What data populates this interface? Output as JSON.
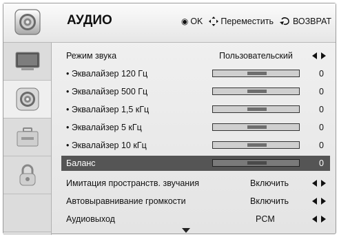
{
  "header": {
    "title": "АУДИО",
    "hint_ok": "OK",
    "hint_move": "Переместить",
    "hint_back": "ВОЗВРАТ"
  },
  "sidebar": {
    "items": [
      {
        "icon": "tv-screen-icon",
        "active": false
      },
      {
        "icon": "speaker-icon",
        "active": true
      },
      {
        "icon": "toolbox-icon",
        "active": false
      },
      {
        "icon": "lock-icon",
        "active": false
      }
    ]
  },
  "settings": [
    {
      "label": "Режим звука",
      "value": "Пользовательский",
      "control": "arrows"
    },
    {
      "label": "• Эквалайзер 120 Гц",
      "value": "0",
      "control": "slider"
    },
    {
      "label": "• Эквалайзер 500 Гц",
      "value": "0",
      "control": "slider"
    },
    {
      "label": "• Эквалайзер 1,5 кГц",
      "value": "0",
      "control": "slider"
    },
    {
      "label": "• Эквалайзер 5 кГц",
      "value": "0",
      "control": "slider"
    },
    {
      "label": "• Эквалайзер 10 кГц",
      "value": "0",
      "control": "slider"
    },
    {
      "label": "Баланс",
      "value": "0",
      "control": "slider",
      "selected": true
    },
    {
      "label": "Имитация пространств. звучания",
      "value": "Включить",
      "control": "arrows"
    },
    {
      "label": "Автовыравнивание громкости",
      "value": "Включить",
      "control": "arrows"
    },
    {
      "label": "Аудиовыход",
      "value": "PCM",
      "control": "arrows"
    }
  ],
  "colors": {
    "selected_row": "#555555",
    "background": "#e8e8e8"
  }
}
